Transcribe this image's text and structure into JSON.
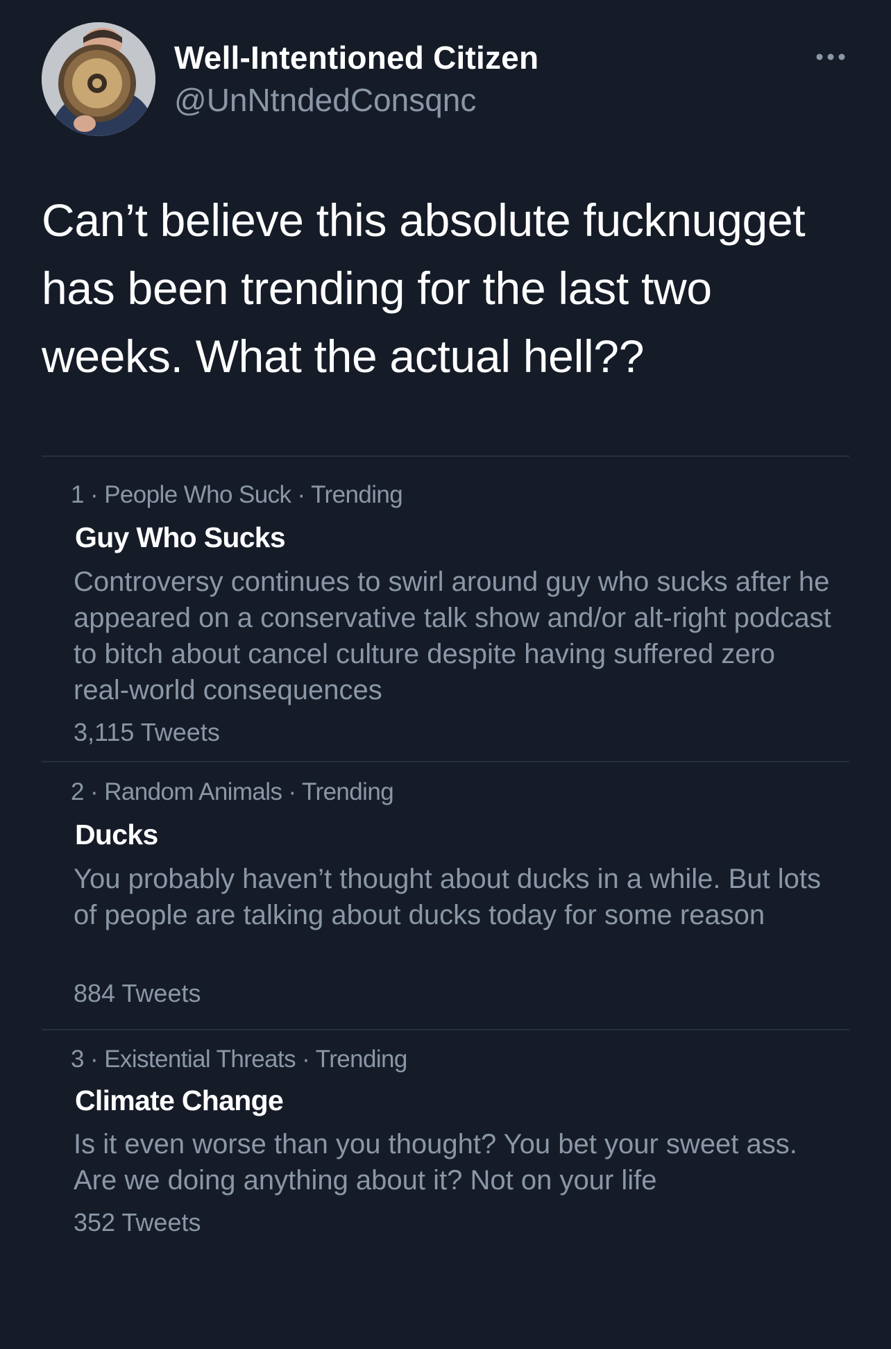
{
  "author": {
    "display_name": "Well-Intentioned Citizen",
    "handle": "@UnNtndedConsqnc",
    "avatar_icon": "person-with-megaphone"
  },
  "tweet": {
    "text": "Can’t believe this absolute fucknugget has been trending for the last two weeks. What the actual hell??"
  },
  "trends": [
    {
      "rank": "1",
      "category": "People Who Suck",
      "status": "Trending",
      "title": "Guy Who Sucks",
      "description": "Controversy continues to swirl around guy who sucks after he appeared on a conservative talk show and/or alt-right podcast to bitch about cancel culture despite having suffered zero real-world consequences",
      "count": "3,115 Tweets"
    },
    {
      "rank": "2",
      "category": "Random Animals",
      "status": "Trending",
      "title": "Ducks",
      "description": "You probably haven’t thought about ducks in a while. But lots of people are talking about ducks today for some reason",
      "count": "884 Tweets"
    },
    {
      "rank": "3",
      "category": "Existential Threats",
      "status": "Trending",
      "title": "Climate Change",
      "description": "Is it even worse than you thought? You bet your sweet ass. Are we doing anything about it? Not on your life",
      "count": "352 Tweets"
    }
  ],
  "colors": {
    "background": "#151c28",
    "primary_text": "#ffffff",
    "secondary_text": "#8b97a6",
    "divider": "#262f3c"
  }
}
